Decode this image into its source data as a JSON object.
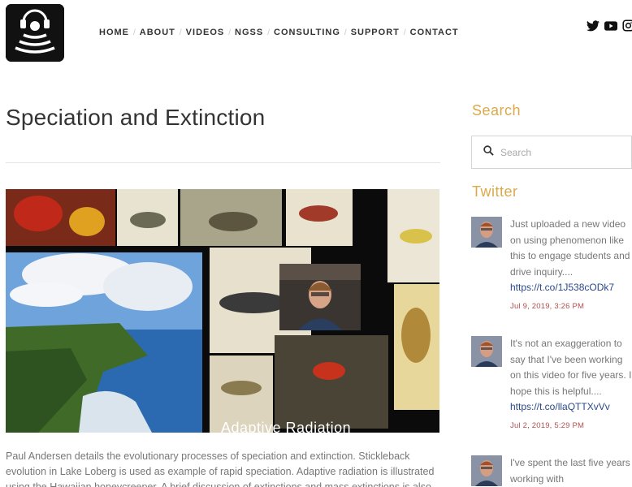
{
  "nav": {
    "items": [
      "HOME",
      "ABOUT",
      "VIDEOS",
      "NGSS",
      "CONSULTING",
      "SUPPORT",
      "CONTACT"
    ]
  },
  "social": [
    "twitter-icon",
    "youtube-icon",
    "instagram-icon"
  ],
  "page": {
    "title": "Speciation and Extinction",
    "video_caption": "Adaptive Radiation",
    "description": "Paul Andersen details the evolutionary processes of speciation and extinction. Stickleback evolution in Lake Loberg is used as example of rapid speciation. Adaptive radiation is illustrated using the Hawaiian honeycreeper. A brief discussion of extinctions and mass extinctions is also"
  },
  "sidebar": {
    "search_heading": "Search",
    "search_placeholder": "Search",
    "twitter_heading": "Twitter",
    "tweets": [
      {
        "text": "Just uploaded a new video on using phenomenon like this to engage students and drive inquiry....",
        "link": "https://t.co/1J538cODk7",
        "date": "Jul 9, 2019, 3:26 PM"
      },
      {
        "text": "It's not an exaggeration to say that I've been working on this video for five years. I hope this is helpful....",
        "link": "https://t.co/llaQTTXvVv",
        "date": "Jul 2, 2019, 5:29 PM"
      },
      {
        "text": "I've spent the last five years working with",
        "link": "",
        "date": ""
      }
    ]
  },
  "colors": {
    "accent": "#d9a94a",
    "link": "#2a4a8a",
    "date": "#b05050"
  }
}
